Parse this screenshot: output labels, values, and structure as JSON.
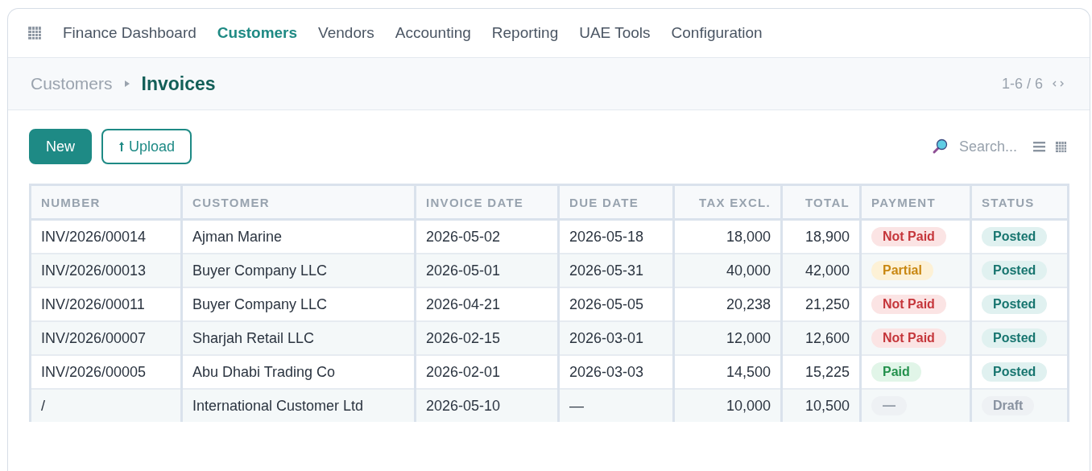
{
  "nav": {
    "items": [
      {
        "label": "Finance Dashboard",
        "selected": false
      },
      {
        "label": "Customers",
        "selected": true
      },
      {
        "label": "Vendors",
        "selected": false
      },
      {
        "label": "Accounting",
        "selected": false
      },
      {
        "label": "Reporting",
        "selected": false
      },
      {
        "label": "UAE Tools",
        "selected": false
      },
      {
        "label": "Configuration",
        "selected": false
      }
    ]
  },
  "breadcrumb": {
    "parent": "Customers",
    "current": "Invoices"
  },
  "pager": {
    "range": "1-6 / 6"
  },
  "toolbar": {
    "buttons": [
      {
        "label": "New",
        "kind": "primary"
      },
      {
        "label": "Upload",
        "kind": "outline"
      }
    ],
    "search": {
      "placeholder": "Search..."
    }
  },
  "table": {
    "columns": [
      "NUMBER",
      "CUSTOMER",
      "INVOICE DATE",
      "DUE DATE",
      "TAX EXCL.",
      "TOTAL",
      "PAYMENT",
      "STATUS"
    ],
    "rows": [
      {
        "number": "INV/2026/00014",
        "customer": "Ajman Marine",
        "invoice_date": "2026-05-02",
        "due_date": "2026-05-18",
        "tax_excl": "18,000",
        "total": "18,900",
        "payment": {
          "label": "Not Paid",
          "kind": "not_paid"
        },
        "status": {
          "label": "Posted",
          "kind": "posted"
        }
      },
      {
        "number": "INV/2026/00013",
        "customer": "Buyer Company LLC",
        "invoice_date": "2026-05-01",
        "due_date": "2026-05-31",
        "tax_excl": "40,000",
        "total": "42,000",
        "payment": {
          "label": "Partial",
          "kind": "partial"
        },
        "status": {
          "label": "Posted",
          "kind": "posted"
        }
      },
      {
        "number": "INV/2026/00011",
        "customer": "Buyer Company LLC",
        "invoice_date": "2026-04-21",
        "due_date": "2026-05-05",
        "tax_excl": "20,238",
        "total": "21,250",
        "payment": {
          "label": "Not Paid",
          "kind": "not_paid"
        },
        "status": {
          "label": "Posted",
          "kind": "posted"
        }
      },
      {
        "number": "INV/2026/00007",
        "customer": "Sharjah Retail LLC",
        "invoice_date": "2026-02-15",
        "due_date": "2026-03-01",
        "tax_excl": "12,000",
        "total": "12,600",
        "payment": {
          "label": "Not Paid",
          "kind": "not_paid"
        },
        "status": {
          "label": "Posted",
          "kind": "posted"
        }
      },
      {
        "number": "INV/2026/00005",
        "customer": "Abu Dhabi Trading Co",
        "invoice_date": "2026-02-01",
        "due_date": "2026-03-03",
        "tax_excl": "14,500",
        "total": "15,225",
        "payment": {
          "label": "Paid",
          "kind": "paid"
        },
        "status": {
          "label": "Posted",
          "kind": "posted"
        }
      },
      {
        "number": "/",
        "customer": "International Customer Ltd",
        "invoice_date": "2026-05-10",
        "due_date": "—",
        "tax_excl": "10,000",
        "total": "10,500",
        "payment": {
          "label": "—",
          "kind": "none"
        },
        "status": {
          "label": "Draft",
          "kind": "draft"
        }
      }
    ]
  }
}
